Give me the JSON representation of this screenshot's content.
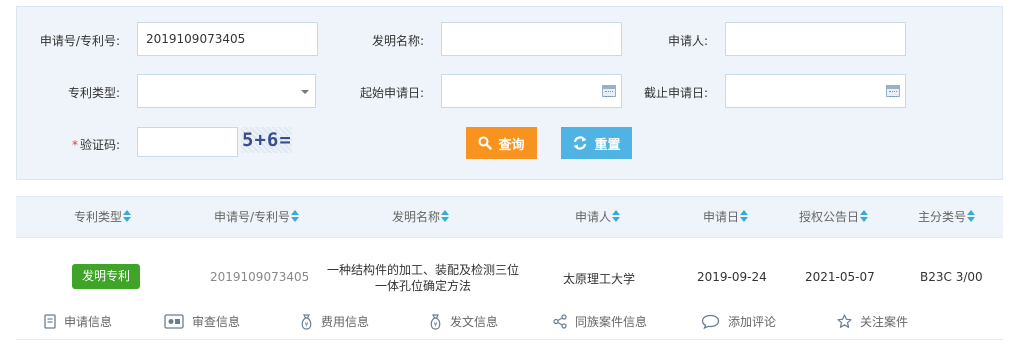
{
  "search": {
    "app_no_label": "申请号/专利号:",
    "app_no_value": "2019109073405",
    "invention_name_label": "发明名称:",
    "invention_name_value": "",
    "applicant_label": "申请人:",
    "applicant_value": "",
    "patent_type_label": "专利类型:",
    "patent_type_value": "",
    "start_date_label": "起始申请日:",
    "start_date_value": "",
    "end_date_label": "截止申请日:",
    "end_date_value": "",
    "captcha_required_mark": "*",
    "captcha_label": "验证码:",
    "captcha_value": "",
    "captcha_image_text": "5+6=",
    "search_button": "查询",
    "reset_button": "重置"
  },
  "results": {
    "columns": [
      "专利类型",
      "申请号/专利号",
      "发明名称",
      "申请人",
      "申请日",
      "授权公告日",
      "主分类号"
    ],
    "rows": [
      {
        "patent_type": "发明专利",
        "app_no": "2019109073405",
        "title": "一种结构件的加工、装配及检测三位一体孔位确定方法",
        "applicant": "太原理工大学",
        "app_date": "2019-09-24",
        "grant_date": "2021-05-07",
        "ipc": "B23C 3/00",
        "actions": [
          "申请信息",
          "审查信息",
          "费用信息",
          "发文信息",
          "同族案件信息",
          "添加评论",
          "关注案件"
        ]
      }
    ]
  },
  "colors": {
    "panel_bg": "#eef4f9",
    "search_button": "#f7931e",
    "reset_button": "#4fb3e3",
    "invention_badge": "#3fa427",
    "sort_icon": "#38a9dc"
  },
  "icons": {
    "search_button_icon": "magnifier-icon",
    "reset_button_icon": "refresh-icon",
    "sort_icons": "sort-updown-icon",
    "actions": [
      "document-icon",
      "review-icon",
      "money-bag-icon",
      "money-bag-icon",
      "share-icon",
      "comment-icon",
      "star-icon"
    ]
  }
}
